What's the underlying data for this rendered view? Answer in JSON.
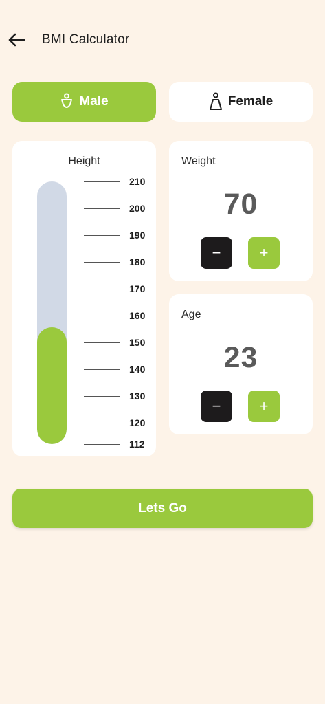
{
  "appbar": {
    "title": "BMI Calculator"
  },
  "gender": {
    "male_label": "Male",
    "female_label": "Female",
    "selected": "Male"
  },
  "height": {
    "label": "Height",
    "scale": [
      "210",
      "200",
      "190",
      "180",
      "170",
      "160",
      "150",
      "140",
      "130",
      "120",
      "112"
    ],
    "min": 112,
    "max": 210,
    "value": 150
  },
  "weight": {
    "label": "Weight",
    "value": "70",
    "minus": "−",
    "plus": "+"
  },
  "age": {
    "label": "Age",
    "value": "23",
    "minus": "−",
    "plus": "+"
  },
  "action": {
    "label": "Lets Go"
  },
  "colors": {
    "accent": "#9ac93d",
    "background": "#fdf3e8",
    "track": "#d1d9e6",
    "dark_button": "#1d1b1c"
  }
}
